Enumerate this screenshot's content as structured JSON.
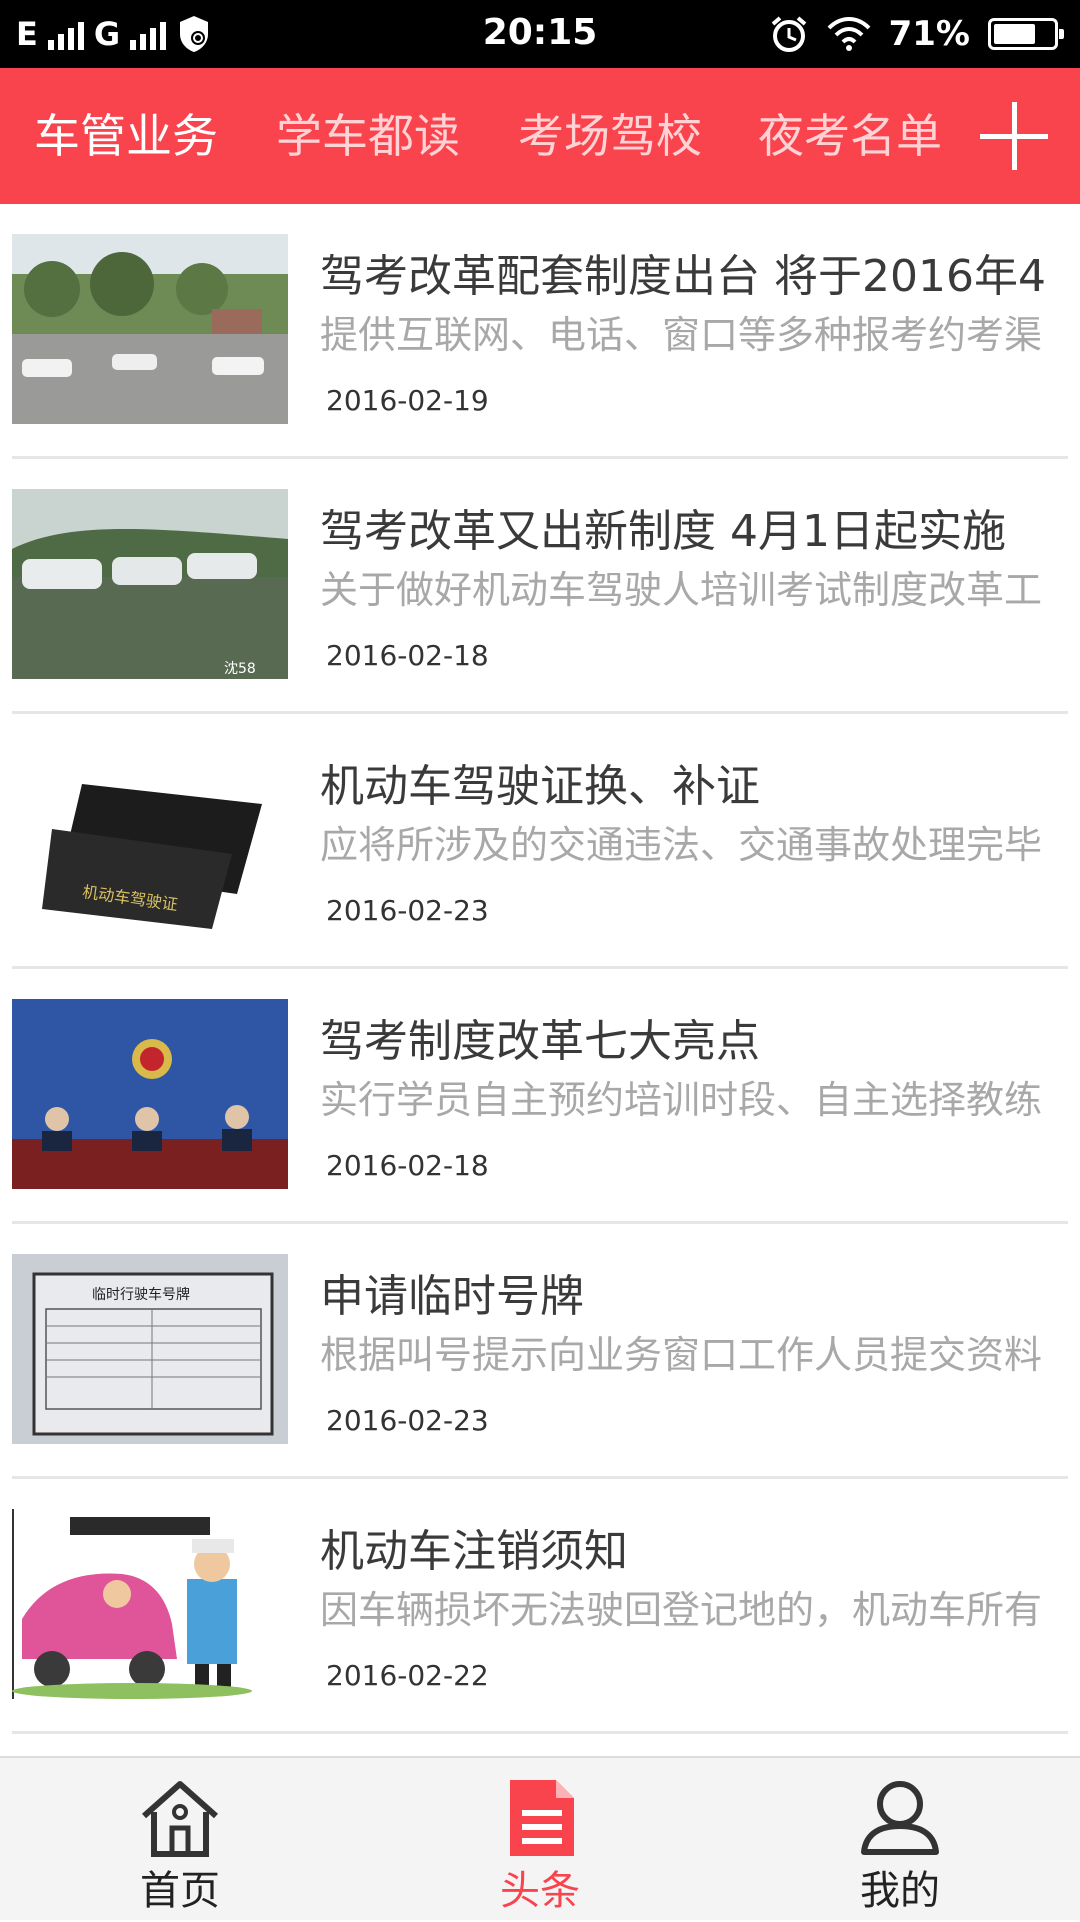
{
  "status_bar": {
    "network1": "E",
    "network2": "G",
    "time": "20:15",
    "battery": "71%",
    "battery_level": 0.71
  },
  "tabs": [
    {
      "label": "车管业务",
      "active": true
    },
    {
      "label": "学车都读",
      "active": false
    },
    {
      "label": "考场驾校",
      "active": false
    },
    {
      "label": "夜考名单",
      "active": false
    }
  ],
  "add_icon": "plus-icon",
  "news": [
    {
      "title": "驾考改革配套制度出台 将于2016年4",
      "summary": "提供互联网、电话、窗口等多种报考约考渠",
      "date": "2016-02-19",
      "thumb": "driving-school-lot"
    },
    {
      "title": "驾考改革又出新制度 4月1日起实施",
      "summary": "关于做好机动车驾驶人培训考试制度改革工",
      "date": "2016-02-18",
      "thumb": "training-cars",
      "thumb_watermark": "沈58"
    },
    {
      "title": "机动车驾驶证换、补证",
      "summary": "应将所涉及的交通违法、交通事故处理完毕",
      "date": "2016-02-23",
      "thumb": "license-booklet",
      "thumb_text": "机动车驾驶证"
    },
    {
      "title": "驾考制度改革七大亮点",
      "summary": "实行学员自主预约培训时段、自主选择教练",
      "date": "2016-02-18",
      "thumb": "press-conference"
    },
    {
      "title": "申请临时号牌",
      "summary": "根据叫号提示向业务窗口工作人员提交资料",
      "date": "2016-02-23",
      "thumb": "temp-plate-form",
      "thumb_text": "临时行驶车号牌"
    },
    {
      "title": "机动车注销须知",
      "summary": "因车辆损坏无法驶回登记地的，机动车所有",
      "date": "2016-02-22",
      "thumb": "police-cartoon"
    }
  ],
  "bottom_nav": [
    {
      "label": "首页",
      "icon": "home-icon",
      "active": false
    },
    {
      "label": "头条",
      "icon": "document-icon",
      "active": true
    },
    {
      "label": "我的",
      "icon": "user-icon",
      "active": false
    }
  ],
  "colors": {
    "accent": "#f9444e",
    "title": "#3a3a3a",
    "summary": "#a8a8a8"
  }
}
